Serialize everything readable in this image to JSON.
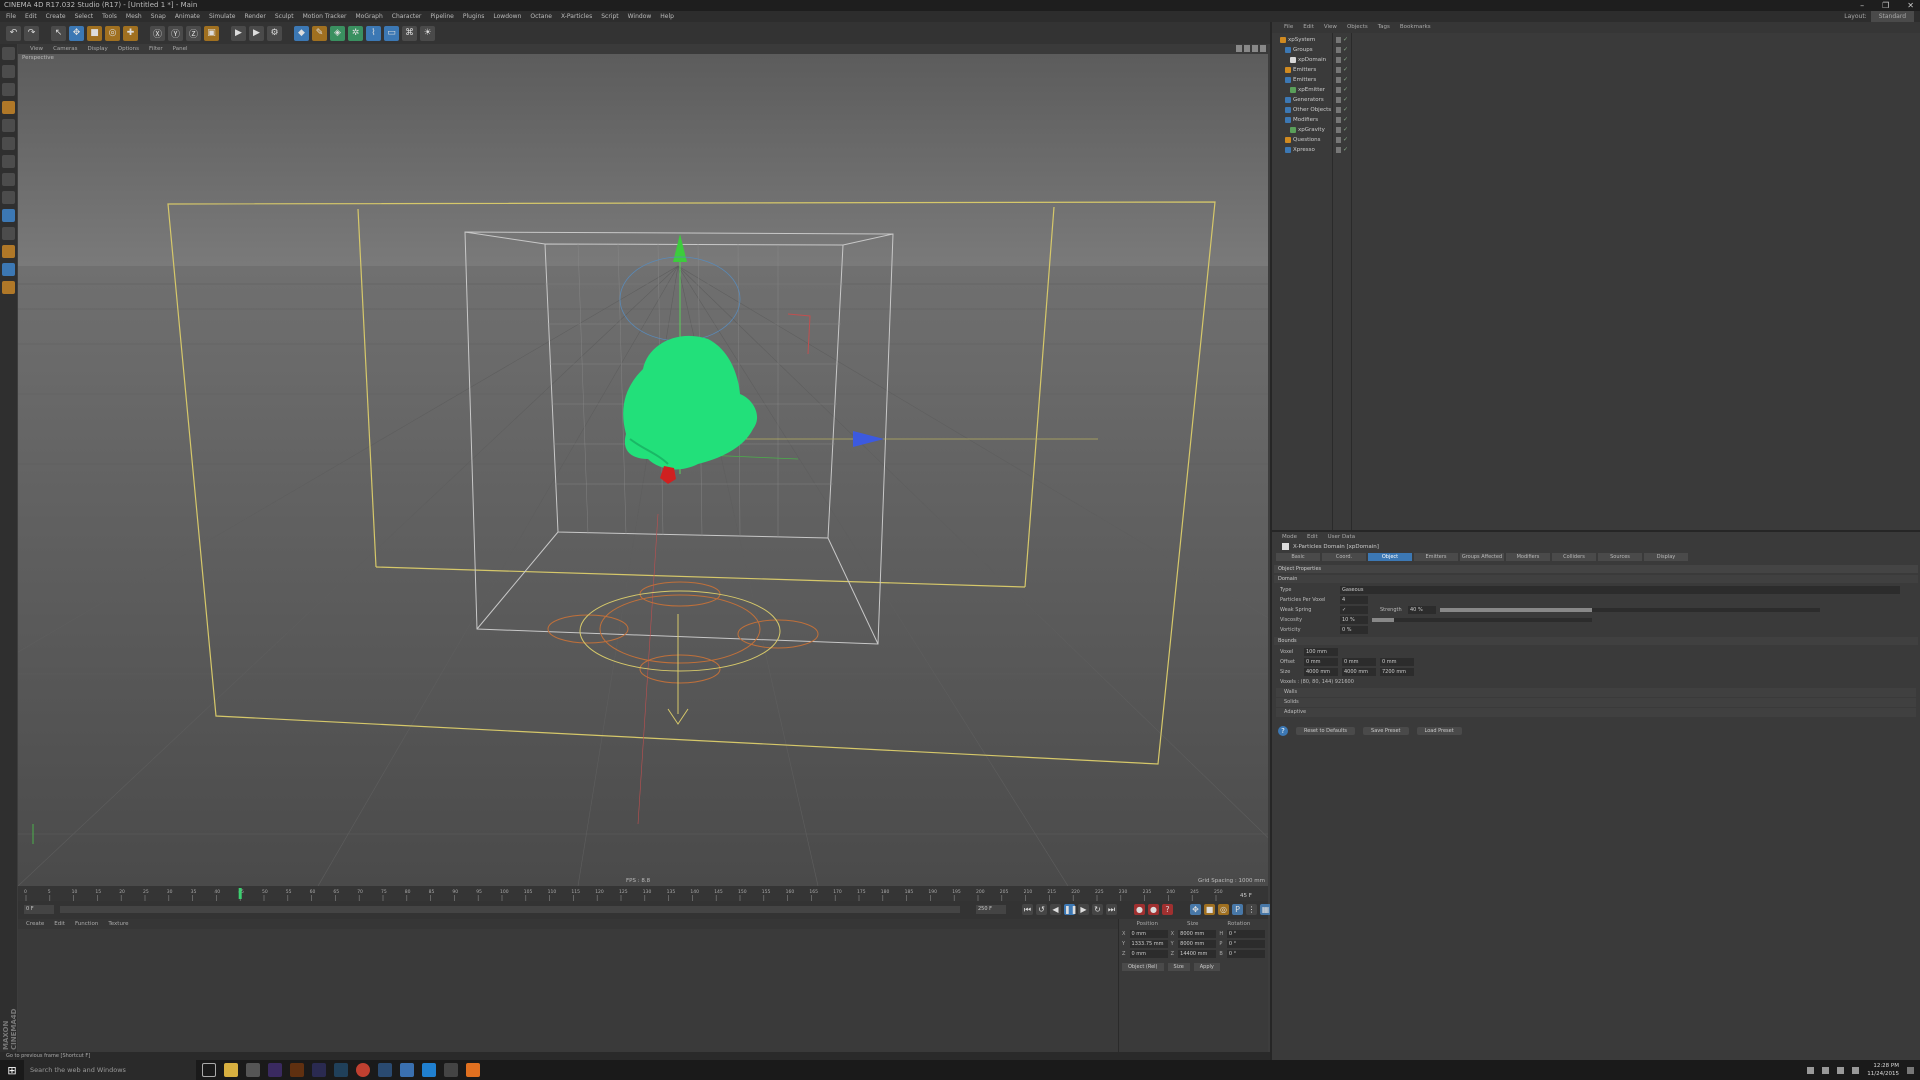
{
  "window": {
    "title": "CINEMA 4D R17.032 Studio (R17) - [Untitled 1 *] - Main",
    "controls": [
      "–",
      "❐",
      "✕"
    ]
  },
  "menubar": [
    "File",
    "Edit",
    "Create",
    "Select",
    "Tools",
    "Mesh",
    "Snap",
    "Animate",
    "Simulate",
    "Render",
    "Sculpt",
    "Motion Tracker",
    "MoGraph",
    "Character",
    "Pipeline",
    "Plugins",
    "Lowdown",
    "Octane",
    "X-Particles",
    "Script",
    "Window",
    "Help"
  ],
  "layout": {
    "label": "Layout:",
    "value": "Standard"
  },
  "viewport": {
    "menu": [
      "View",
      "Cameras",
      "Display",
      "Options",
      "Filter",
      "Panel"
    ],
    "camera_label": "Perspective",
    "fps": "FPS : 8.8",
    "grid_spacing": "Grid Spacing : 1000 mm"
  },
  "timeline": {
    "ticks": [
      "0",
      "5",
      "10",
      "15",
      "20",
      "25",
      "30",
      "35",
      "40",
      "45",
      "50",
      "55",
      "60",
      "65",
      "70",
      "75",
      "80",
      "85",
      "90",
      "95",
      "100",
      "105",
      "110",
      "115",
      "120",
      "125",
      "130",
      "135",
      "140",
      "145",
      "150",
      "155",
      "160",
      "165",
      "170",
      "175",
      "180",
      "185",
      "190",
      "195",
      "200",
      "205",
      "210",
      "215",
      "220",
      "225",
      "230",
      "235",
      "240",
      "245",
      "250"
    ],
    "current_frame": "45 F",
    "start": "0 F",
    "end": "250 F"
  },
  "material_manager": {
    "menu": [
      "Create",
      "Edit",
      "Function",
      "Texture"
    ]
  },
  "coordinates": {
    "headers": [
      "Position",
      "Size",
      "Rotation"
    ],
    "rows": [
      {
        "axis": "X",
        "pos": "0 mm",
        "size_axis": "X",
        "size": "8000 mm",
        "rot_axis": "H",
        "rot": "0 °"
      },
      {
        "axis": "Y",
        "pos": "1333.75 mm",
        "size_axis": "Y",
        "size": "8000 mm",
        "rot_axis": "P",
        "rot": "0 °"
      },
      {
        "axis": "Z",
        "pos": "0 mm",
        "size_axis": "Z",
        "size": "14400 mm",
        "rot_axis": "B",
        "rot": "0 °"
      }
    ],
    "mode": "Object (Rel)",
    "size_mode": "Size",
    "apply": "Apply"
  },
  "status": "Go to previous frame [Shortcut F]",
  "cineware": "MAXON CINEMA4D",
  "object_manager": {
    "menu": [
      "File",
      "Edit",
      "View",
      "Objects",
      "Tags",
      "Bookmarks"
    ],
    "objects": [
      {
        "name": "xpSystem",
        "indent": 0,
        "color": "#d08a20"
      },
      {
        "name": "Groups",
        "indent": 1,
        "color": "#3c78b4"
      },
      {
        "name": "xpDomain",
        "indent": 2,
        "color": "#d8d8d8"
      },
      {
        "name": "Emitters",
        "indent": 1,
        "color": "#d08a20"
      },
      {
        "name": "Emitters",
        "indent": 1,
        "color": "#3c78b4"
      },
      {
        "name": "xpEmitter",
        "indent": 2,
        "color": "#5aa05a"
      },
      {
        "name": "Generators",
        "indent": 1,
        "color": "#3c78b4"
      },
      {
        "name": "Other Objects",
        "indent": 1,
        "color": "#3c78b4"
      },
      {
        "name": "Modifiers",
        "indent": 1,
        "color": "#3c78b4"
      },
      {
        "name": "xpGravity",
        "indent": 2,
        "color": "#5aa05a"
      },
      {
        "name": "Questions",
        "indent": 1,
        "color": "#d08a20"
      },
      {
        "name": "Xpresso",
        "indent": 1,
        "color": "#3c78b4"
      }
    ]
  },
  "attributes": {
    "menu": [
      "Mode",
      "Edit",
      "User Data"
    ],
    "title": "X-Particles Domain [xpDomain]",
    "tabs": [
      "Basic",
      "Coord.",
      "Object",
      "Emitters",
      "Groups Affected",
      "Modifiers",
      "Colliders",
      "Sources",
      "Display"
    ],
    "selected_tab": "Object",
    "section_title": "Object Properties",
    "domain_section": "Domain",
    "rows": [
      {
        "name": "Type",
        "value": "Gaseous"
      },
      {
        "name": "Particles Per Voxel",
        "value": "4"
      },
      {
        "name": "Weak Spring",
        "value": "✓"
      },
      {
        "name": "Viscosity",
        "value": "10 %"
      },
      {
        "name": "Vorticity",
        "value": "0 %"
      }
    ],
    "strength_label": "Strength",
    "strength_value": "40 %",
    "strength_fraction": 0.4,
    "viscosity_fraction": 0.1,
    "bounds_section": "Bounds",
    "bounds": [
      {
        "name": "Voxel",
        "v": [
          "100 mm"
        ]
      },
      {
        "name": "Offset",
        "v": [
          "0 mm",
          "0 mm",
          "0 mm"
        ]
      },
      {
        "name": "Size",
        "v": [
          "4000 mm",
          "4000 mm",
          "7200 mm"
        ]
      }
    ],
    "voxels_info": "Voxels : (80, 80, 144) 921600",
    "collapsed": [
      "Walls",
      "Solids",
      "Adaptive"
    ],
    "buttons": [
      "Reset to Defaults",
      "Save Preset",
      "Load Preset"
    ]
  },
  "taskbar": {
    "search": "Search the web and Windows",
    "time": "12:28 PM",
    "date": "11/24/2015"
  }
}
